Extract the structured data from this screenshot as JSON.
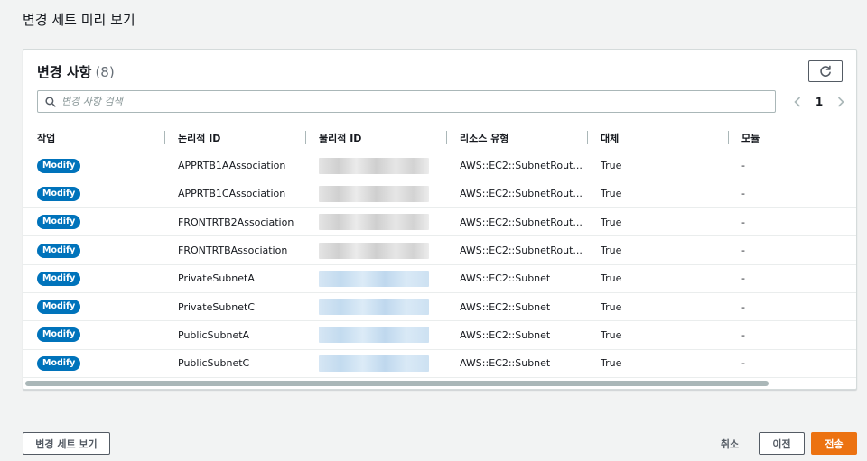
{
  "page": {
    "title": "변경 세트 미리 보기"
  },
  "panel": {
    "title": "변경 사항",
    "count": "(8)",
    "search_placeholder": "변경 사항 검색",
    "page_number": "1"
  },
  "table": {
    "columns": [
      "작업",
      "논리적 ID",
      "물리적 ID",
      "리소스 유형",
      "대체",
      "모듈"
    ],
    "rows": [
      {
        "action": "Modify",
        "logical_id": "APPRTB1AAssociation",
        "physical_tone": "gray",
        "type": "AWS::EC2::SubnetRout...",
        "replace": "True",
        "module": "-"
      },
      {
        "action": "Modify",
        "logical_id": "APPRTB1CAssociation",
        "physical_tone": "gray",
        "type": "AWS::EC2::SubnetRout...",
        "replace": "True",
        "module": "-"
      },
      {
        "action": "Modify",
        "logical_id": "FRONTRTB2Association",
        "physical_tone": "gray",
        "type": "AWS::EC2::SubnetRout...",
        "replace": "True",
        "module": "-"
      },
      {
        "action": "Modify",
        "logical_id": "FRONTRTBAssociation",
        "physical_tone": "gray",
        "type": "AWS::EC2::SubnetRout...",
        "replace": "True",
        "module": "-"
      },
      {
        "action": "Modify",
        "logical_id": "PrivateSubnetA",
        "physical_tone": "blue",
        "type": "AWS::EC2::Subnet",
        "replace": "True",
        "module": "-"
      },
      {
        "action": "Modify",
        "logical_id": "PrivateSubnetC",
        "physical_tone": "blue",
        "type": "AWS::EC2::Subnet",
        "replace": "True",
        "module": "-"
      },
      {
        "action": "Modify",
        "logical_id": "PublicSubnetA",
        "physical_tone": "blue",
        "type": "AWS::EC2::Subnet",
        "replace": "True",
        "module": "-"
      },
      {
        "action": "Modify",
        "logical_id": "PublicSubnetC",
        "physical_tone": "blue",
        "type": "AWS::EC2::Subnet",
        "replace": "True",
        "module": "-"
      }
    ]
  },
  "footer": {
    "view_changeset_label": "변경 세트 보기",
    "cancel_label": "취소",
    "previous_label": "이전",
    "submit_label": "전송"
  },
  "colors": {
    "badge": "#0073bb",
    "primary": "#ec7211",
    "background": "#f2f3f3"
  }
}
